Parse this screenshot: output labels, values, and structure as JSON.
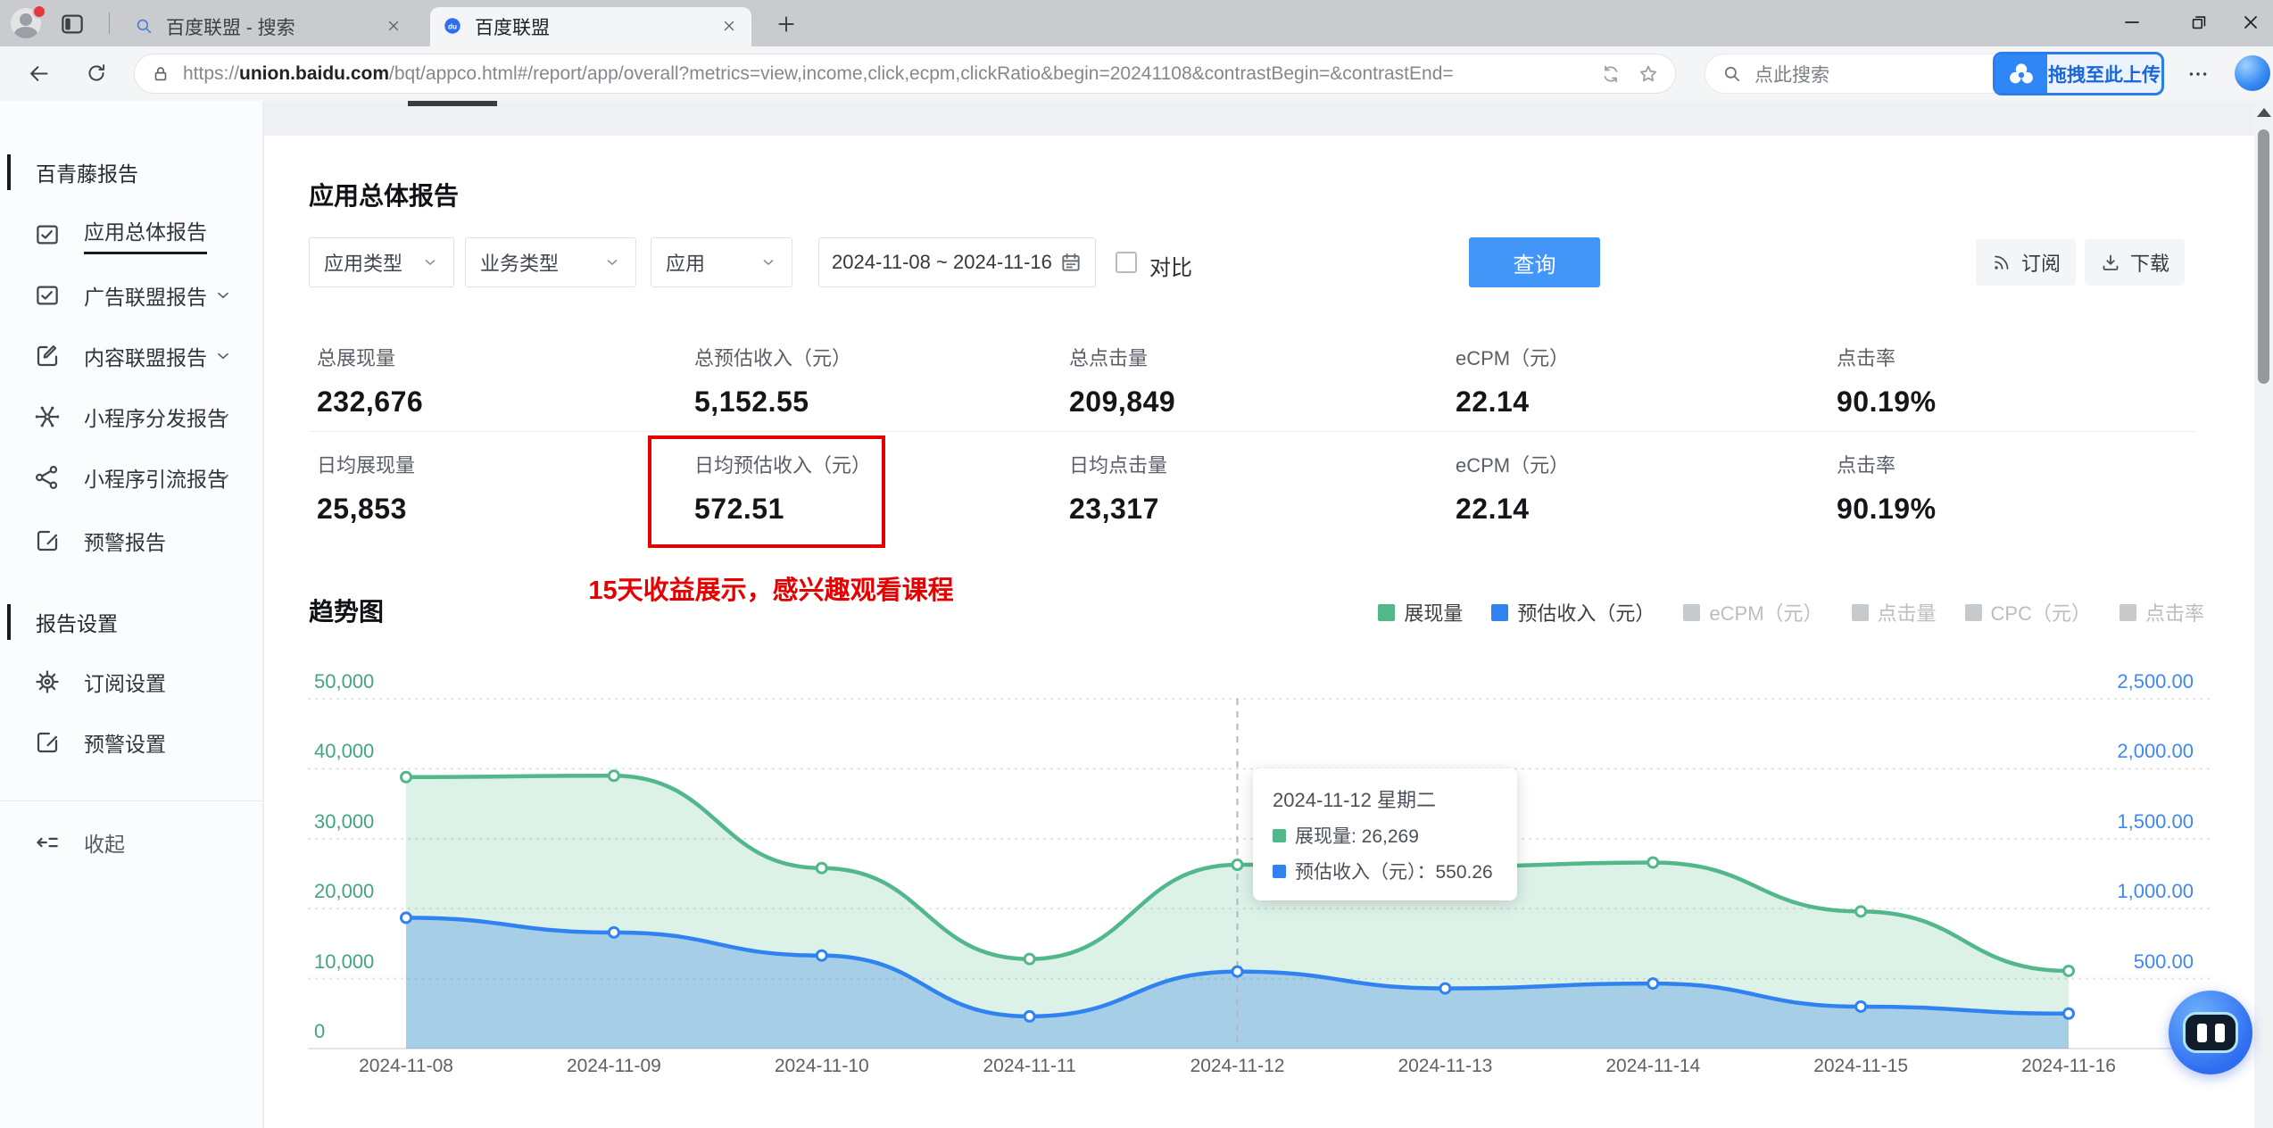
{
  "browser": {
    "tabs": [
      {
        "title": "百度联盟 - 搜索",
        "active": false
      },
      {
        "title": "百度联盟",
        "active": true
      }
    ],
    "url": {
      "scheme": "https://",
      "host": "union.baidu.com",
      "path": "/bqt/appco.html#/report/app/overall?metrics=view,income,click,ecpm,clickRatio&begin=20241108&contrastBegin=&contrastEnd="
    },
    "search_placeholder": "点此搜索",
    "upload_label": "拖拽至此上传"
  },
  "sidebar": {
    "section_reports": "百青藤报告",
    "report_items": [
      {
        "label": "应用总体报告",
        "icon": "report",
        "active": true,
        "chevron": false
      },
      {
        "label": "广告联盟报告",
        "icon": "report",
        "active": false,
        "chevron": true
      },
      {
        "label": "内容联盟报告",
        "icon": "content",
        "active": false,
        "chevron": true
      },
      {
        "label": "小程序分发报告",
        "icon": "dispatch",
        "active": false,
        "chevron": true
      },
      {
        "label": "小程序引流报告",
        "icon": "share",
        "active": false,
        "chevron": true
      },
      {
        "label": "预警报告",
        "icon": "alert",
        "active": false,
        "chevron": false
      }
    ],
    "section_settings": "报告设置",
    "setting_items": [
      {
        "label": "订阅设置",
        "icon": "gear"
      },
      {
        "label": "预警设置",
        "icon": "alert"
      }
    ],
    "collapse_label": "收起"
  },
  "main": {
    "title": "应用总体报告",
    "filters": {
      "selects": [
        "应用类型",
        "业务类型",
        "应用"
      ],
      "date_range": "2024-11-08 ~ 2024-11-16",
      "compare_label": "对比",
      "query_label": "查询"
    },
    "actions": {
      "subscribe": "订阅",
      "download": "下载"
    },
    "stats_row1": [
      {
        "label": "总展现量",
        "value": "232,676"
      },
      {
        "label": "总预估收入（元）",
        "value": "5,152.55"
      },
      {
        "label": "总点击量",
        "value": "209,849"
      },
      {
        "label": "eCPM（元）",
        "value": "22.14"
      },
      {
        "label": "点击率",
        "value": "90.19%"
      }
    ],
    "stats_row2": [
      {
        "label": "日均展现量",
        "value": "25,853"
      },
      {
        "label": "日均预估收入（元）",
        "value": "572.51",
        "highlighted": true
      },
      {
        "label": "日均点击量",
        "value": "23,317"
      },
      {
        "label": "eCPM（元）",
        "value": "22.14"
      },
      {
        "label": "点击率",
        "value": "90.19%"
      }
    ],
    "annotation": "15天收益展示，感兴趣观看课程",
    "chart_title": "趋势图"
  },
  "chart_data": {
    "type": "area",
    "title": "趋势图",
    "x": [
      "2024-11-08",
      "2024-11-09",
      "2024-11-10",
      "2024-11-11",
      "2024-11-12",
      "2024-11-13",
      "2024-11-14",
      "2024-11-15",
      "2024-11-16"
    ],
    "series": [
      {
        "name": "展现量",
        "axis": "left",
        "color": "#53b78c",
        "fill": "rgba(97,191,149,0.22)",
        "values": [
          38800,
          39000,
          25800,
          12800,
          26269,
          26000,
          26600,
          19600,
          11100
        ]
      },
      {
        "name": "预估收入（元）",
        "axis": "right",
        "color": "#2f82f0",
        "fill": "rgba(64,139,230,0.34)",
        "values": [
          935,
          830,
          665,
          230,
          550.26,
          430,
          465,
          300,
          250
        ]
      }
    ],
    "left_axis": {
      "min": 0,
      "max": 50000,
      "tick_labels": [
        "0",
        "10,000",
        "20,000",
        "30,000",
        "40,000",
        "50,000"
      ]
    },
    "right_axis": {
      "min": 0,
      "max": 2500,
      "tick_labels": [
        "0",
        "500.00",
        "1,000.00",
        "1,500.00",
        "2,000.00",
        "2,500.00"
      ]
    },
    "legend": [
      {
        "label": "展现量",
        "color": "#53b78c",
        "active": true
      },
      {
        "label": "预估收入（元）",
        "color": "#2f82f0",
        "active": true
      },
      {
        "label": "eCPM（元）",
        "color": "#c7cacd",
        "active": false
      },
      {
        "label": "点击量",
        "color": "#c7cacd",
        "active": false
      },
      {
        "label": "CPC（元）",
        "color": "#c7cacd",
        "active": false
      },
      {
        "label": "点击率",
        "color": "#c7cacd",
        "active": false
      }
    ],
    "cursor_index": 4,
    "tooltip": {
      "title": "2024-11-12 星期二",
      "rows": [
        {
          "text": "展现量: 26,269",
          "color": "#53b78c"
        },
        {
          "text": "预估收入（元）：550.26",
          "color": "#2f82f0"
        }
      ]
    }
  }
}
